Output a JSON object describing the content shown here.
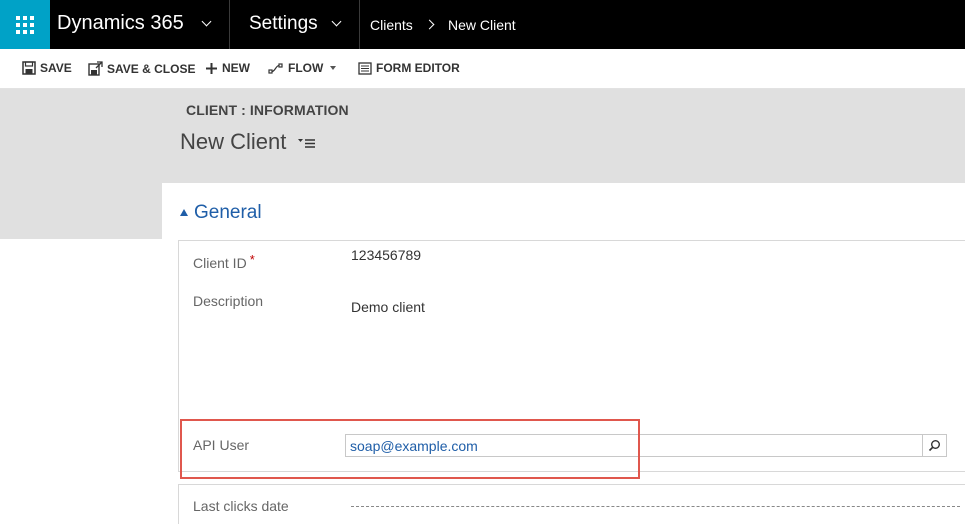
{
  "nav": {
    "app_name": "Dynamics 365",
    "area_name": "Settings",
    "breadcrumb": [
      "Clients",
      "New Client"
    ],
    "icons": [
      "waffle-icon",
      "chevron-down-icon",
      "chevron-right-icon"
    ]
  },
  "toolbar": {
    "save": "SAVE",
    "save_close": "SAVE & CLOSE",
    "new": "NEW",
    "flow": "FLOW",
    "form_editor": "FORM EDITOR"
  },
  "header": {
    "entity_label": "CLIENT : INFORMATION",
    "title": "New Client"
  },
  "section": {
    "title": "General"
  },
  "fields": {
    "client_id": {
      "label": "Client ID",
      "required_mark": "*",
      "value": "123456789"
    },
    "description": {
      "label": "Description",
      "value": "Demo client"
    },
    "api_user": {
      "label": "API User",
      "value": "soap@example.com"
    },
    "last_clicks_date": {
      "label": "Last clicks date",
      "value": ""
    }
  },
  "colors": {
    "topbar": "#000000",
    "waffle": "#00a2c7",
    "accent_blue": "#1f5ea8",
    "highlight": "#e0574d",
    "required": "#c00000"
  }
}
